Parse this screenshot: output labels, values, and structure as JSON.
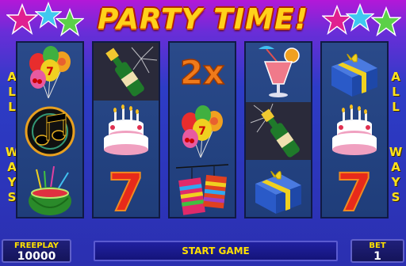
{
  "title": "PARTY TIME!",
  "side_labels": {
    "left": [
      "A",
      "L",
      "L",
      "W",
      "A",
      "Y",
      "S"
    ],
    "right": [
      "A",
      "L",
      "L",
      "W",
      "A",
      "Y",
      "S"
    ]
  },
  "reels": [
    [
      "balloons",
      "music-note",
      "watermelon-drink"
    ],
    [
      "champagne",
      "birthday-cake",
      "seven"
    ],
    [
      "multiplier-2x",
      "balloons",
      "gift-bags"
    ],
    [
      "cocktail",
      "champagne",
      "gift-box"
    ],
    [
      "gift-box",
      "birthday-cake",
      "seven"
    ]
  ],
  "multiplier_text": "2x",
  "seven_text": "7",
  "freeplay": {
    "label": "FREEPLAY",
    "value": "10000"
  },
  "start_button": "START GAME",
  "bet": {
    "label": "BET",
    "value": "1"
  },
  "colors": {
    "title": "#ffd21a",
    "side_label": "#ffe21a",
    "reel_bg": "#2a4a8a",
    "panel_label": "#ffe000"
  }
}
